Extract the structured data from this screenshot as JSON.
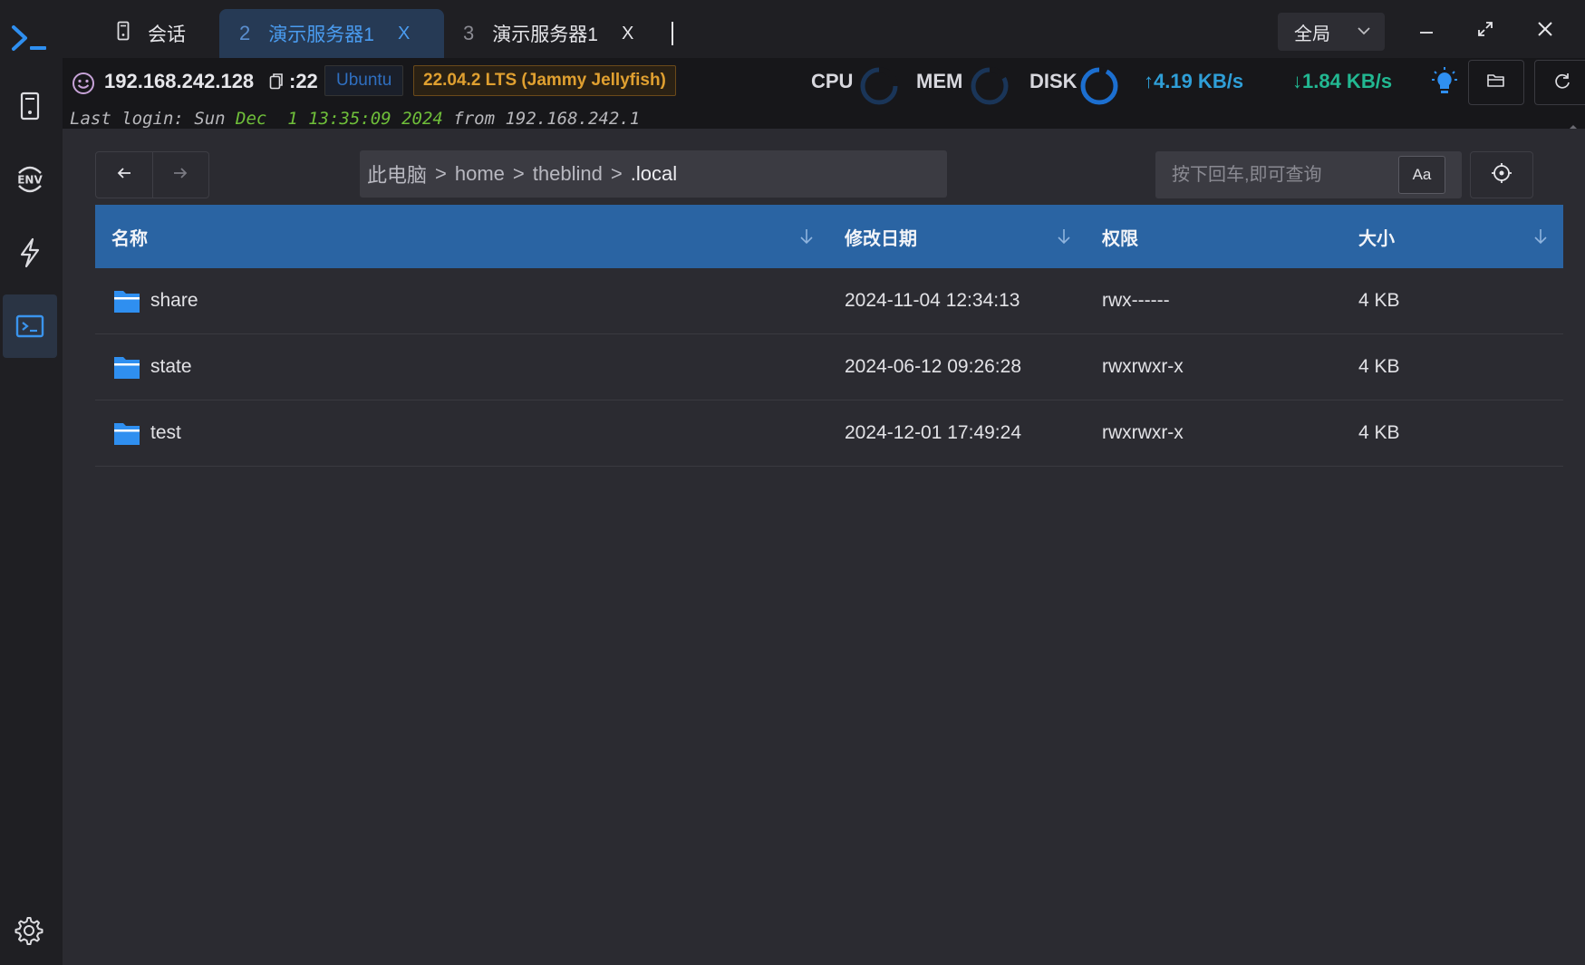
{
  "colors": {
    "accent": "#2a64a3",
    "tab_active": "#4a9cf0",
    "upload": "#2f9fd8",
    "download": "#22b892",
    "version_badge": "#e0a030"
  },
  "rail": {
    "items": [
      {
        "name": "server-list",
        "icon": "phone-device-icon"
      },
      {
        "name": "env",
        "icon": "env-icon"
      },
      {
        "name": "quick-command",
        "icon": "lightning-icon"
      },
      {
        "name": "terminal",
        "icon": "terminal-icon",
        "active": true
      }
    ],
    "settings_icon": "gear-icon"
  },
  "tabs": {
    "session_label": "会话",
    "items": [
      {
        "index": "2",
        "title": "演示服务器1",
        "close": "X",
        "active": true
      },
      {
        "index": "3",
        "title": "演示服务器1",
        "close": "X",
        "active": false
      }
    ]
  },
  "scope": {
    "label": "全局"
  },
  "status": {
    "ip": "192.168.242.128",
    "port": ":22",
    "os": "Ubuntu",
    "version": "22.04.2 LTS (Jammy Jellyfish)",
    "cpu_label": "CPU",
    "mem_label": "MEM",
    "disk_label": "DISK",
    "upload": "↑4.19 KB/s",
    "download": "↓1.84 KB/s",
    "last_login_prefix": "Last login: Sun ",
    "last_login_month": "Dec",
    "last_login_date": "  1 13:35:09 2024",
    "last_login_suffix": " from 192.168.242.1"
  },
  "browser": {
    "path": [
      "此电脑",
      "home",
      "theblind",
      ".local"
    ],
    "path_sep": ">",
    "search_placeholder": "按下回车,即可查询",
    "case_label": "Aa",
    "columns": {
      "name": "名称",
      "modified": "修改日期",
      "perm": "权限",
      "size": "大小"
    },
    "rows": [
      {
        "name": "share",
        "modified": "2024-11-04 12:34:13",
        "perm": "rwx------",
        "size": "4 KB"
      },
      {
        "name": "state",
        "modified": "2024-06-12 09:26:28",
        "perm": "rwxrwxr-x",
        "size": "4 KB"
      },
      {
        "name": "test",
        "modified": "2024-12-01 17:49:24",
        "perm": "rwxrwxr-x",
        "size": "4 KB"
      }
    ]
  }
}
